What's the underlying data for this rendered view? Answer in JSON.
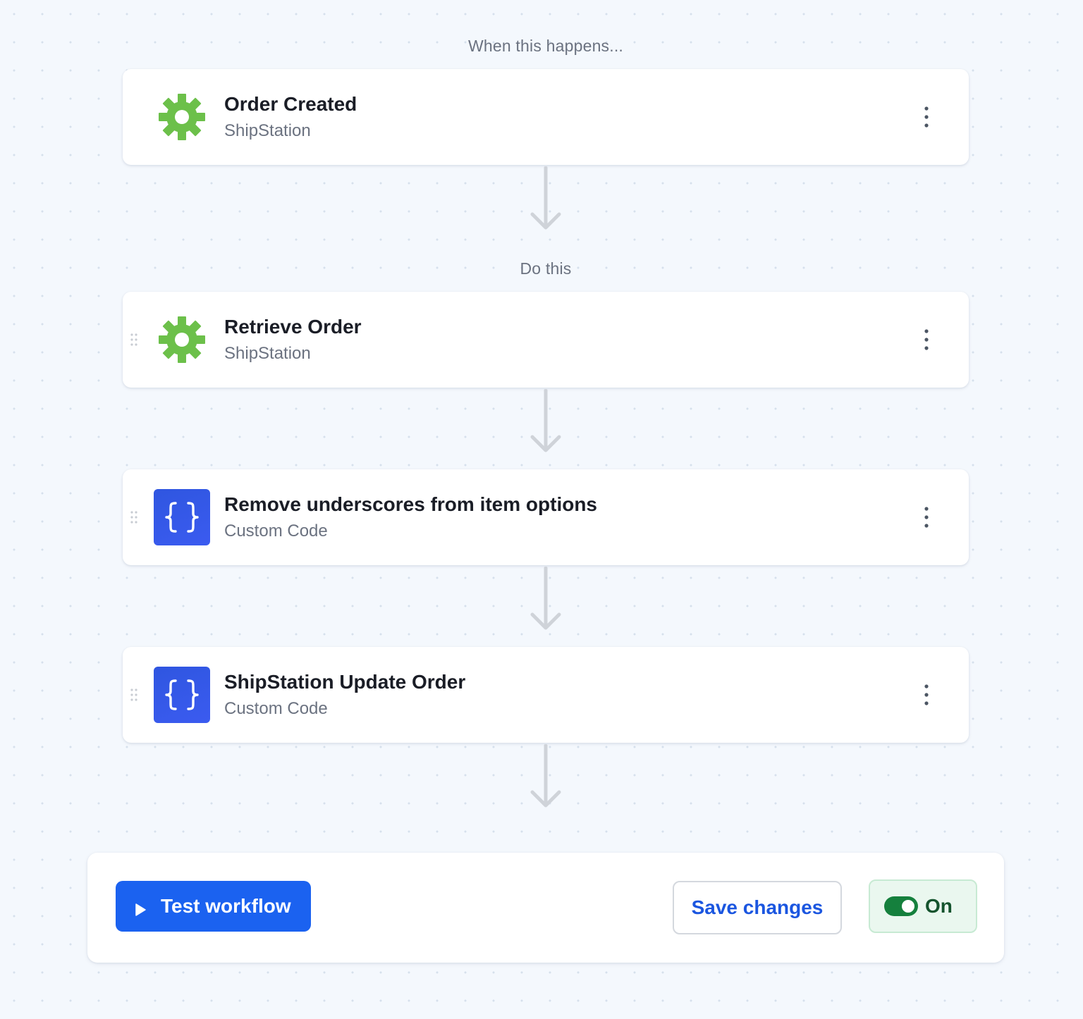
{
  "trigger_section": {
    "label": "When this happens..."
  },
  "actions_section": {
    "label": "Do this"
  },
  "steps": [
    {
      "title": "Order Created",
      "app": "ShipStation",
      "icon": "gear-icon",
      "icon_color": "#6cc04a",
      "draggable": false
    },
    {
      "title": "Retrieve Order",
      "app": "ShipStation",
      "icon": "gear-icon",
      "icon_color": "#6cc04a",
      "draggable": true
    },
    {
      "title": "Remove underscores from item options",
      "app": "Custom Code",
      "icon": "curly-braces-icon",
      "icon_color": "#3457e8",
      "draggable": true
    },
    {
      "title": "ShipStation Update Order",
      "app": "Custom Code",
      "icon": "curly-braces-icon",
      "icon_color": "#3457e8",
      "draggable": true
    }
  ],
  "action_bar": {
    "test_label": "Test workflow",
    "save_label": "Save changes",
    "toggle_label": "On",
    "toggle_on": true,
    "primary_color": "#1b62f0",
    "toggle_color": "#15803d"
  }
}
